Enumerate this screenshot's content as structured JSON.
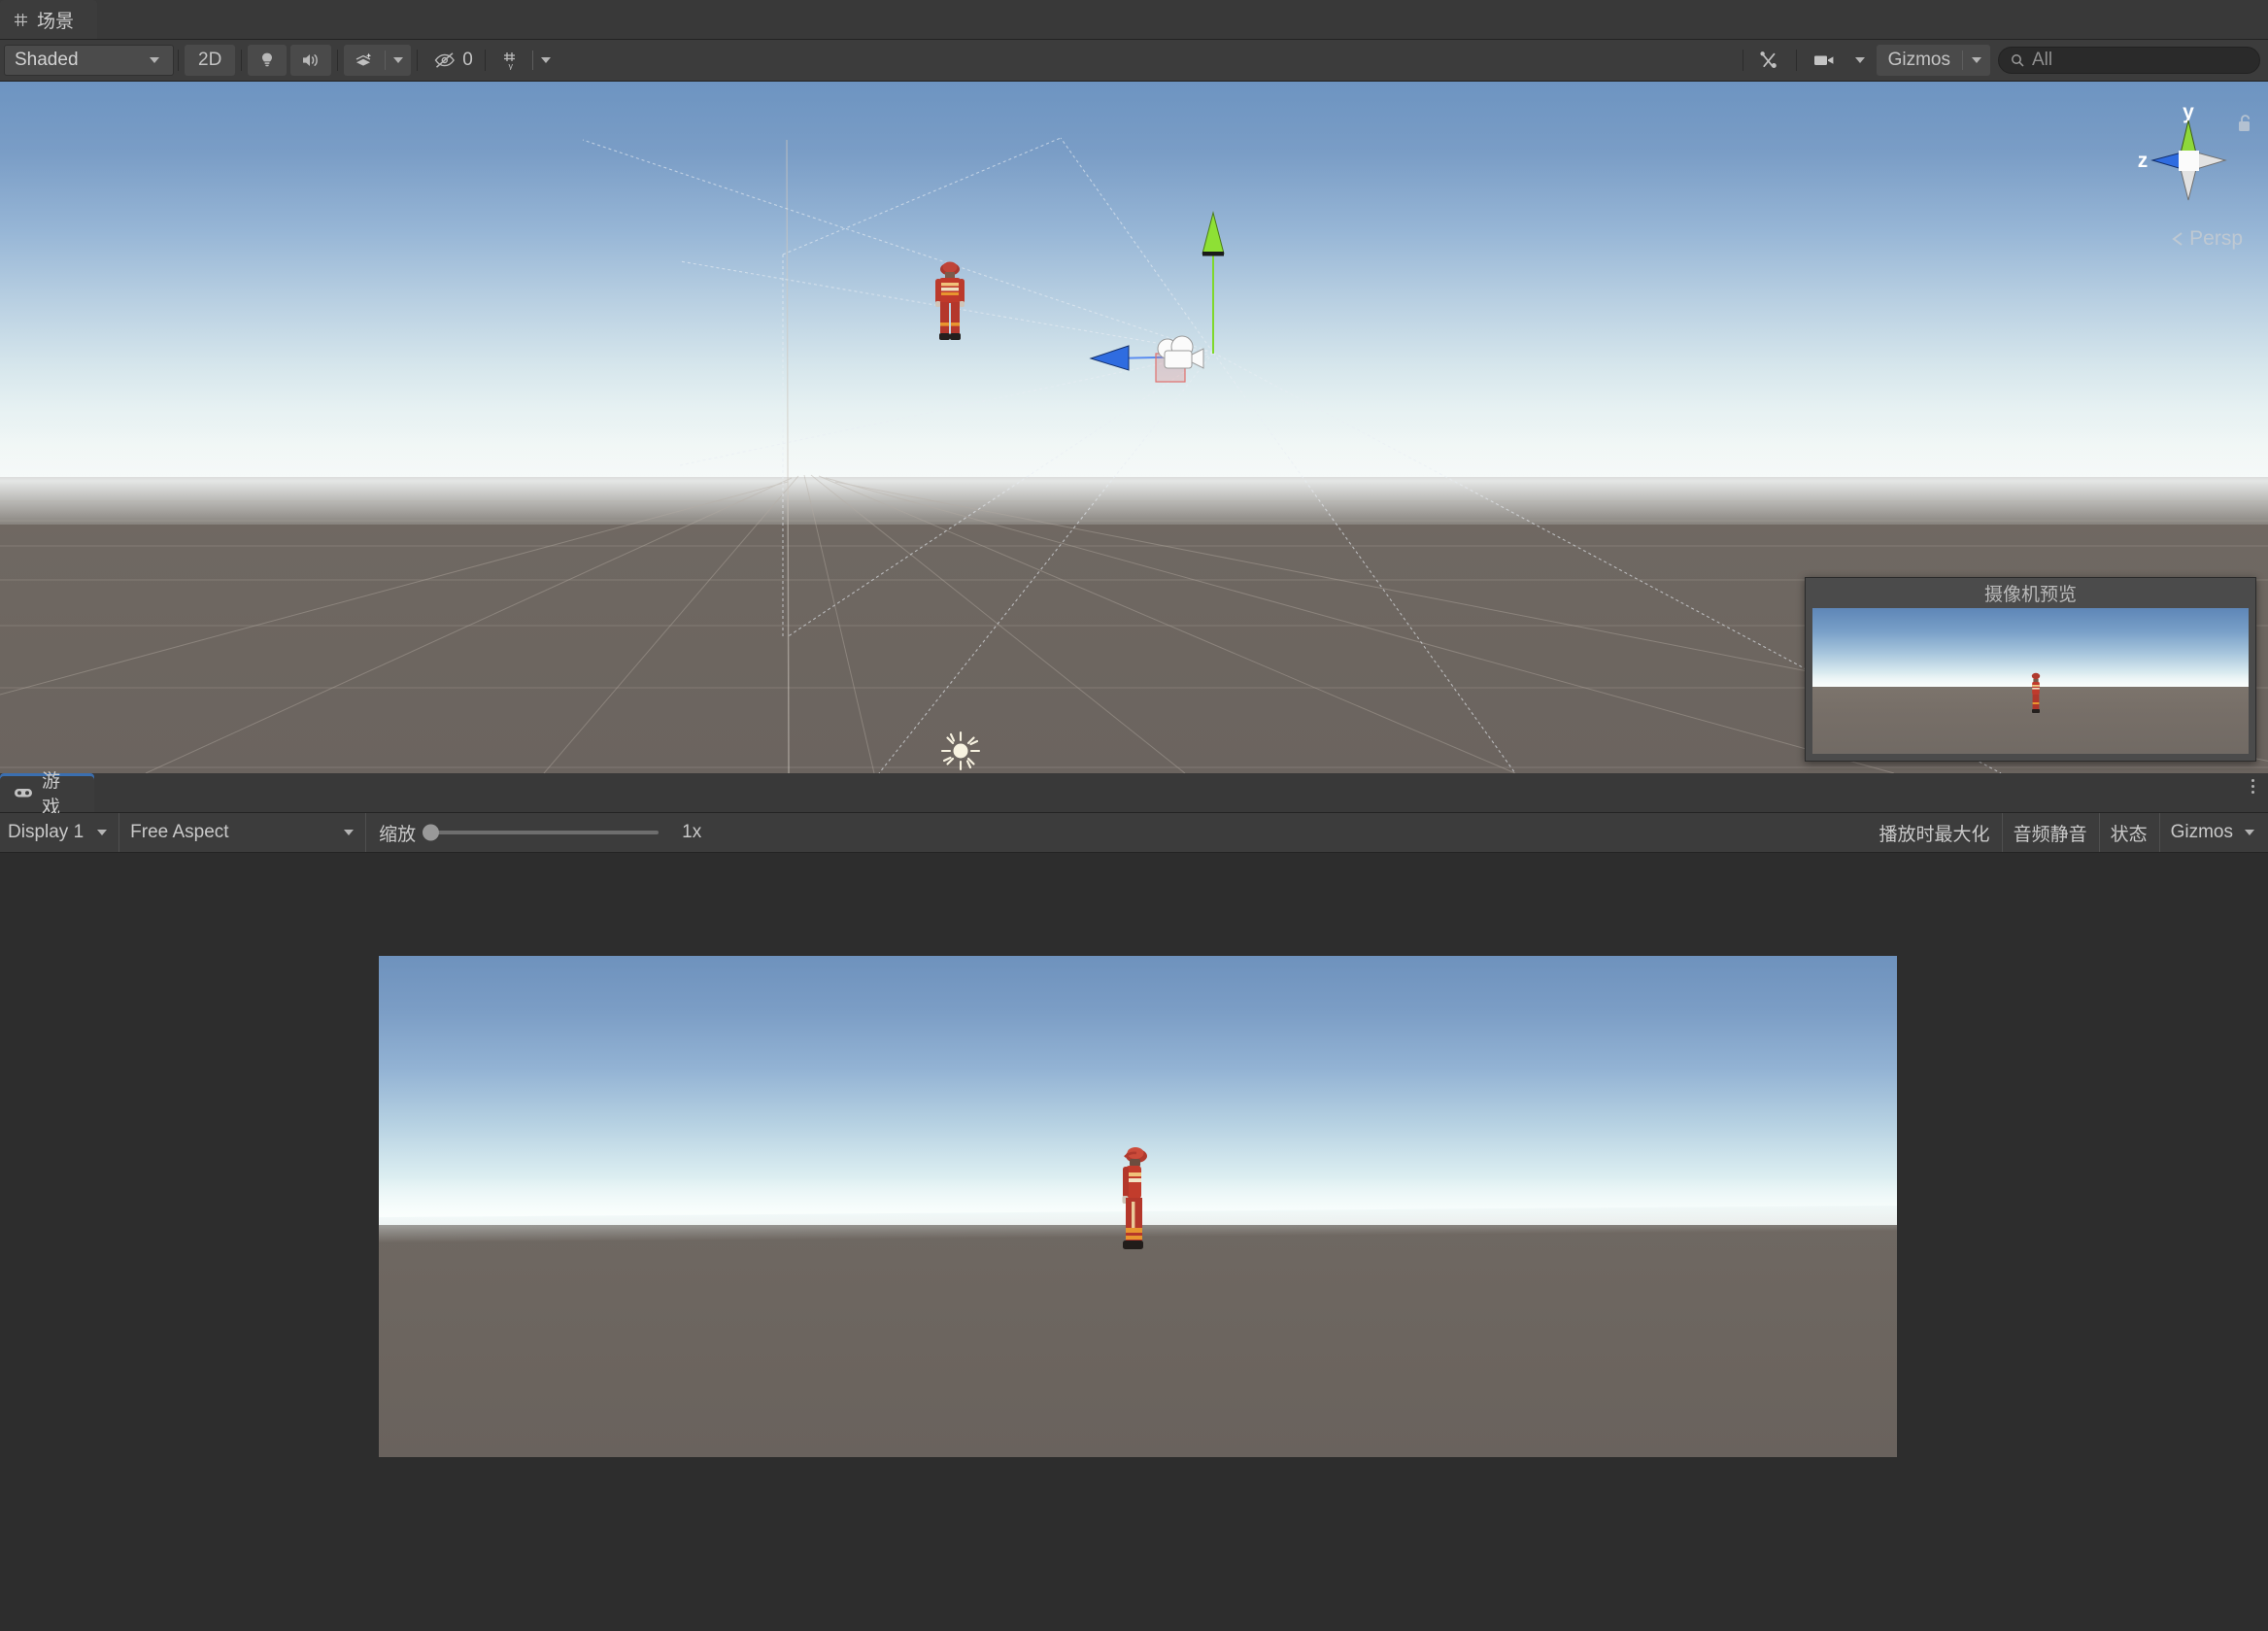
{
  "app": {
    "editor": "Unity Editor"
  },
  "scene_panel": {
    "tab": {
      "label": "场景",
      "icon": "scene-grid-icon"
    },
    "toolbar": {
      "draw_mode": {
        "label": "Shaded",
        "icon": "chevron-down-icon"
      },
      "mode_2d": {
        "label": "2D"
      },
      "lighting_toggle": {
        "icon": "lightbulb-icon"
      },
      "audio_toggle": {
        "icon": "speaker-icon"
      },
      "effects": {
        "icon": "effects-icon",
        "dropdown_icon": "chevron-down-icon"
      },
      "hidden_objects": {
        "label": "0",
        "icon": "eye-off-icon"
      },
      "grid": {
        "icon": "grid-axis-icon",
        "dropdown_icon": "chevron-down-icon"
      },
      "tool_settings": {
        "icon": "tools-icon"
      },
      "camera_settings": {
        "icon": "video-camera-icon",
        "dropdown_icon": "chevron-down-icon"
      },
      "gizmos": {
        "label": "Gizmos",
        "dropdown_icon": "chevron-down-icon"
      },
      "search": {
        "value": "All",
        "placeholder": "All",
        "icon": "search-icon"
      }
    },
    "axis_gizmo": {
      "y_label": "y",
      "z_label": "z",
      "projection": "Persp",
      "projection_arrow": "left-chevron-icon",
      "lock": "unlocked-padlock-icon",
      "colors": {
        "y_axis": "#8cd836",
        "z_axis": "#3b6fe0",
        "other_axis": "#d8d8d8"
      }
    },
    "camera_preview": {
      "title": "摄像机预览"
    },
    "gizmos_in_scene": {
      "selected_object": "camera-gizmo",
      "move_handle_y": "#7fd82b",
      "move_handle_z": "#3a6fe4",
      "selection_rect": "#e06a6a",
      "light_gizmo": "sun-icon",
      "character": "firefighter-character"
    },
    "colors": {
      "sky_top": "#6d94c1",
      "horizon": "#eef5f4",
      "ground": "#6d6660"
    }
  },
  "game_panel": {
    "tab": {
      "label": "游戏",
      "icon": "gamepad-icon"
    },
    "overflow_menu": {
      "icon": "kebab-menu-icon"
    },
    "toolbar": {
      "display": {
        "label": "Display 1",
        "icon": "chevron-down-icon"
      },
      "aspect": {
        "label": "Free Aspect",
        "icon": "chevron-down-icon"
      },
      "scale": {
        "label": "缩放",
        "value": "1x",
        "position_pct": 0
      },
      "maximize_on_play": {
        "label": "播放时最大化"
      },
      "mute_audio": {
        "label": "音频静音"
      },
      "stats": {
        "label": "状态"
      },
      "gizmos": {
        "label": "Gizmos",
        "icon": "chevron-down-icon"
      }
    },
    "render": {
      "character": "firefighter-character",
      "background": "#2d2d2d"
    }
  }
}
